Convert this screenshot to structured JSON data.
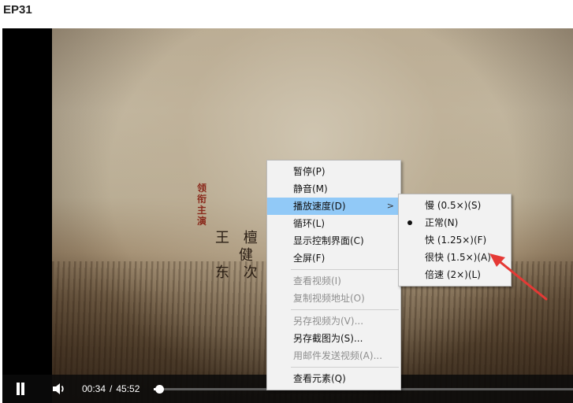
{
  "page": {
    "title": "EP31"
  },
  "video": {
    "credits": {
      "vertical": "领衔主演",
      "line1": "王 檀 .",
      "line2": "健 ",
      "line3": "东 次 ."
    }
  },
  "controls": {
    "pause_icon": "pause-icon",
    "volume_icon": "volume-icon",
    "current_time": "00:34",
    "separator": "/",
    "duration": "45:52",
    "progress_fraction": 0.0124
  },
  "context_menu": {
    "items": [
      {
        "label": "暂停(P)",
        "disabled": false
      },
      {
        "label": "静音(M)",
        "disabled": false
      },
      {
        "label": "播放速度(D)",
        "disabled": false,
        "highlighted": true,
        "submenu_arrow": ">"
      },
      {
        "label": "循环(L)",
        "disabled": false
      },
      {
        "label": "显示控制界面(C)",
        "disabled": false
      },
      {
        "label": "全屏(F)",
        "disabled": false
      },
      {
        "label": "查看视频(I)",
        "disabled": true
      },
      {
        "label": "复制视频地址(O)",
        "disabled": true
      },
      {
        "label": "另存视频为(V)...",
        "disabled": true
      },
      {
        "label": "另存截图为(S)...",
        "disabled": false
      },
      {
        "label": "用邮件发送视频(A)...",
        "disabled": true
      },
      {
        "label": "查看元素(Q)",
        "disabled": false
      }
    ]
  },
  "speed_submenu": {
    "items": [
      {
        "label": "慢 (0.5×)(S)",
        "checked": false
      },
      {
        "label": "正常(N)",
        "checked": true
      },
      {
        "label": "快 (1.25×)(F)",
        "checked": false
      },
      {
        "label": "很快 (1.5×)(A)",
        "checked": false
      },
      {
        "label": "倍速 (2×)(L)",
        "checked": false
      }
    ]
  },
  "annotation": {
    "color": "#e53935"
  }
}
